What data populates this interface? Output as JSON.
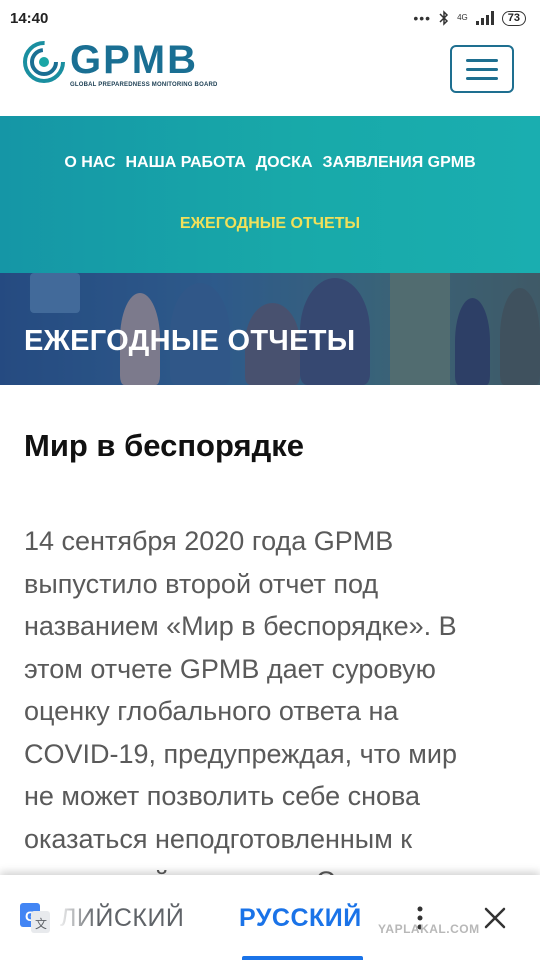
{
  "status_bar": {
    "time": "14:40",
    "network": "4G",
    "battery": "73"
  },
  "header": {
    "logo_word": "GPMB",
    "logo_subtitle": "GLOBAL PREPAREDNESS MONITORING BOARD"
  },
  "nav": {
    "items": [
      "О НАС",
      "НАША РАБОТА",
      "ДОСКА",
      "ЗАЯВЛЕНИЯ GPMB"
    ],
    "active_item": "ЕЖЕГОДНЫЕ ОТЧЕТЫ"
  },
  "hero": {
    "title": "ЕЖЕГОДНЫЕ ОТЧЕТЫ"
  },
  "article": {
    "title": "Мир в беспорядке",
    "lines": [
      "14 сентября 2020 года GPMB",
      "выпустило второй отчет под",
      "названием «Мир в беспорядке». В",
      "этом отчете GPMB дает суровую",
      "оценку глобального ответа на",
      "COVID-19, предупреждая, что мир",
      "не может позволить себе снова",
      "оказаться неподготовленным к",
      "следующей пандемии. Совет"
    ]
  },
  "translate_bar": {
    "source_language": "ЛИЙСКИЙ",
    "target_language": "РУССКИЙ"
  },
  "watermark": "YAPLAKAL.COM",
  "colors": {
    "brand_blue": "#1a6f93",
    "nav_teal": "#18a9a9",
    "nav_active": "#f1e05a",
    "translate_blue": "#1a73e8"
  }
}
